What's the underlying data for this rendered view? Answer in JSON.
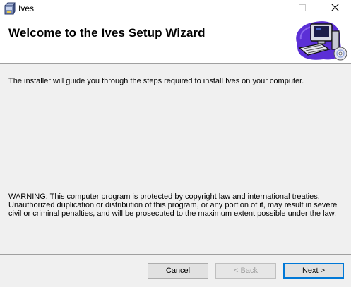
{
  "window": {
    "title": "Ives",
    "icons": {
      "app": "installer-box-icon",
      "minimize": "minimize-icon",
      "maximize": "maximize-icon",
      "close": "close-icon"
    }
  },
  "header": {
    "title": "Welcome to the Ives Setup Wizard",
    "art": "computer-cd-icon"
  },
  "body": {
    "intro": "The installer will guide you through the steps required to install Ives on your computer.",
    "warning": "WARNING: This computer program is protected by copyright law and international treaties. Unauthorized duplication or distribution of this program, or any portion of it, may result in severe civil or criminal penalties, and will be prosecuted to the maximum extent possible under the law."
  },
  "buttons": {
    "cancel": "Cancel",
    "back": "< Back",
    "next": "Next >"
  },
  "colors": {
    "window_bg": "#f0f0f0",
    "header_bg": "#ffffff",
    "focus_border": "#0078d7",
    "disabled_text": "#a0a0a0"
  }
}
